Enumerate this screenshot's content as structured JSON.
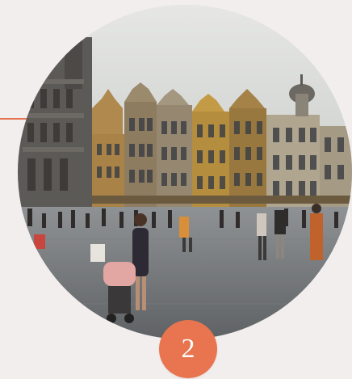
{
  "step": {
    "number": "2"
  },
  "colors": {
    "background": "#f3eeee",
    "accent": "#e8754f",
    "accent_line": "#e3734f"
  },
  "photo": {
    "subject": "town-square-photo"
  }
}
